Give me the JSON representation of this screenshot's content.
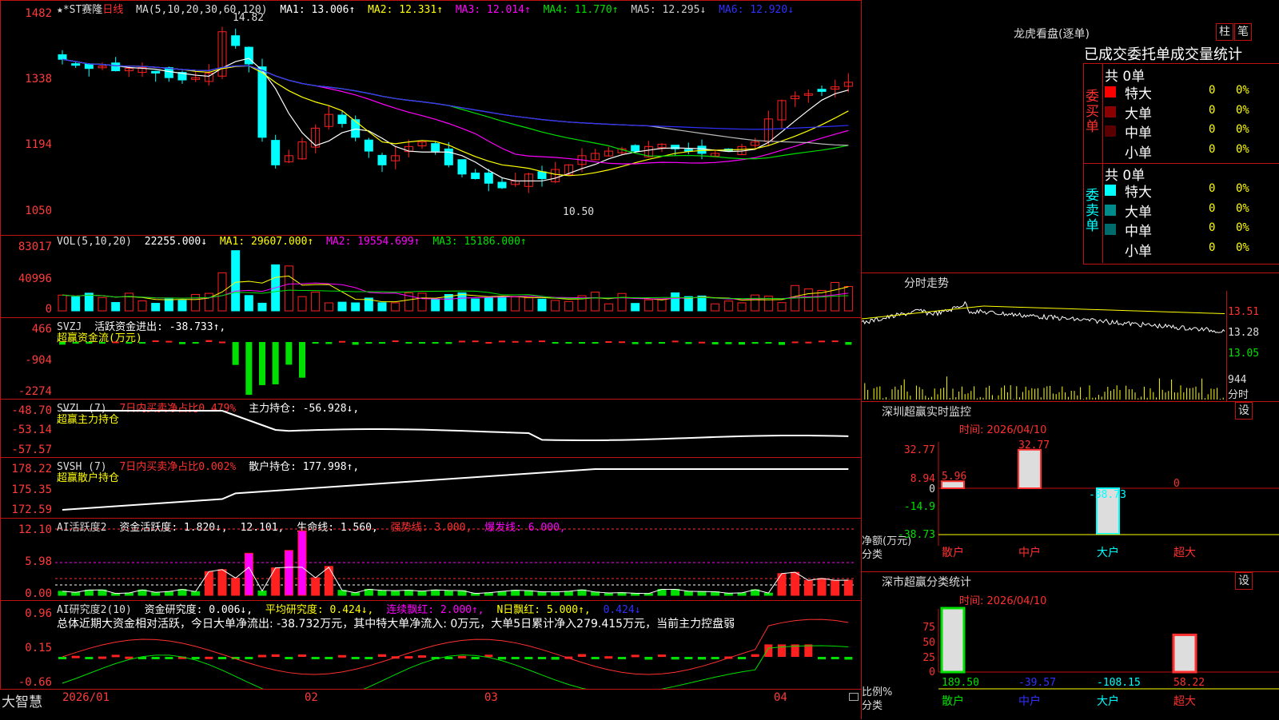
{
  "header": {
    "price_top": "1482",
    "stock_name": "★*ST赛隆",
    "period": "日线",
    "ma_label": "MA(5,10,20,30,60,120)",
    "ma1": "MA1: 13.006↑",
    "ma2": "MA2: 12.331↑",
    "ma3": "MA3: 12.014↑",
    "ma4": "MA4: 11.770↑",
    "ma5": "MA5: 12.295↓",
    "ma6": "MA6: 12.920↓"
  },
  "price_axis": [
    "1482",
    "1338",
    "1194",
    "1050"
  ],
  "price_annotations": {
    "high": "14.82",
    "low": "10.50"
  },
  "volume": {
    "label": "VOL(5,10,20)",
    "value": "22255.000↓",
    "ma1": "MA1: 29607.000↑",
    "ma2": "MA2: 19554.699↑",
    "ma3": "MA3: 15186.000↑",
    "axis": [
      "83017",
      "40996",
      "0"
    ]
  },
  "svzj": {
    "label": "SVZJ",
    "text": "活跃资金进出: -38.733↑,",
    "sub": "超赢资金流(万元)",
    "axis": [
      "466",
      "-904",
      "-2274"
    ]
  },
  "svzl": {
    "label": "SVZL (7)",
    "ratio": "7日内买卖净占比0.479%",
    "text": "主力持仓: -56.928↓,",
    "sub": "超赢主力持仓",
    "axis": [
      "-48.70",
      "-53.14",
      "-57.57"
    ]
  },
  "svsh": {
    "label": "SVSH (7)",
    "ratio": "7日内买卖净占比0.002%",
    "text": "散户持仓: 177.998↑,",
    "sub": "超赢散户持仓",
    "axis": [
      "178.22",
      "175.35",
      "172.59"
    ]
  },
  "ai_active": {
    "label": "AI活跃度2",
    "t1": "资金活跃度: 1.820↓,",
    "t2": "12.101,",
    "t3": "生命线: 1.560,",
    "t4": "强势线: 3.000,",
    "t5": "爆发线: 6.000,",
    "axis": [
      "12.10",
      "5.98",
      "0.00"
    ]
  },
  "ai_research": {
    "label": "AI研究度2(10)",
    "t1": "资金研究度: 0.006↓,",
    "t2": "平均研究度: 0.424↓,",
    "t3": "连续飘红: 2.000↑,",
    "t4": "N日飘红: 5.000↑,",
    "t5": "0.424↓",
    "summary": "总体近期大资金相对活跃，今日大单净流出: -38.732万元，其中特大单净流入: 0万元，大单5日累计净入279.415万元，当前主力控盘弱",
    "axis": [
      "0.96",
      "0.15",
      "-0.66"
    ]
  },
  "date_axis": [
    "2026/01",
    "02",
    "03",
    "04"
  ],
  "brand": "大智慧",
  "dragon_tiger": {
    "title": "龙虎看盘(逐单)",
    "btn1": "柱",
    "btn2": "笔",
    "header": "已成交委托单成交量统计",
    "buy_label": "委买单",
    "sell_label": "委卖单",
    "buy_total": "共 0单",
    "sell_total": "共 0单",
    "buy_rows": [
      {
        "name": "特大",
        "count": "0",
        "pct": "0%",
        "color": "#ff0000"
      },
      {
        "name": "大单",
        "count": "0",
        "pct": "0%",
        "color": "#8b0000"
      },
      {
        "name": "中单",
        "count": "0",
        "pct": "0%",
        "color": "#5a0000"
      },
      {
        "name": "小单",
        "count": "0",
        "pct": "0%",
        "color": "#000000"
      }
    ],
    "sell_rows": [
      {
        "name": "特大",
        "count": "0",
        "pct": "0%",
        "color": "#00ffff"
      },
      {
        "name": "大单",
        "count": "0",
        "pct": "0%",
        "color": "#008b8b"
      },
      {
        "name": "中单",
        "count": "0",
        "pct": "0%",
        "color": "#006b6b"
      },
      {
        "name": "小单",
        "count": "0",
        "pct": "0%",
        "color": "#000000"
      }
    ]
  },
  "intraday": {
    "title": "分时走势",
    "axis": [
      "13.51",
      "13.28",
      "13.05"
    ],
    "vol": "944",
    "vol_label": "分时"
  },
  "sz_monitor": {
    "title": "深圳超赢实时监控",
    "btn": "设",
    "time": "时间: 2026/04/10",
    "axis": [
      "32.77",
      "8.94",
      "0",
      "-14.9",
      "-38.73"
    ],
    "unit": "净额(万元)",
    "cat_label": "分类",
    "values": {
      "retail": "5.96",
      "mid": "32.77",
      "large": "-38.73",
      "super": "0"
    },
    "cats": [
      "散户",
      "中户",
      "大户",
      "超大"
    ]
  },
  "sz_stats": {
    "title": "深市超赢分类统计",
    "btn": "设",
    "time": "时间: 2026/04/10",
    "axis": [
      "75",
      "50",
      "25",
      "0"
    ],
    "ratio_label": "比例%",
    "cat_label": "分类",
    "values": [
      "189.50",
      "-39.57",
      "-108.15",
      "58.22"
    ],
    "cats": [
      "散户",
      "中户",
      "大户",
      "超大"
    ]
  },
  "colors": {
    "up": "#ff2020",
    "down": "#00ffff",
    "border": "#c01010",
    "green": "#00e000",
    "magenta": "#ff00ff",
    "yellow": "#ffff00"
  }
}
